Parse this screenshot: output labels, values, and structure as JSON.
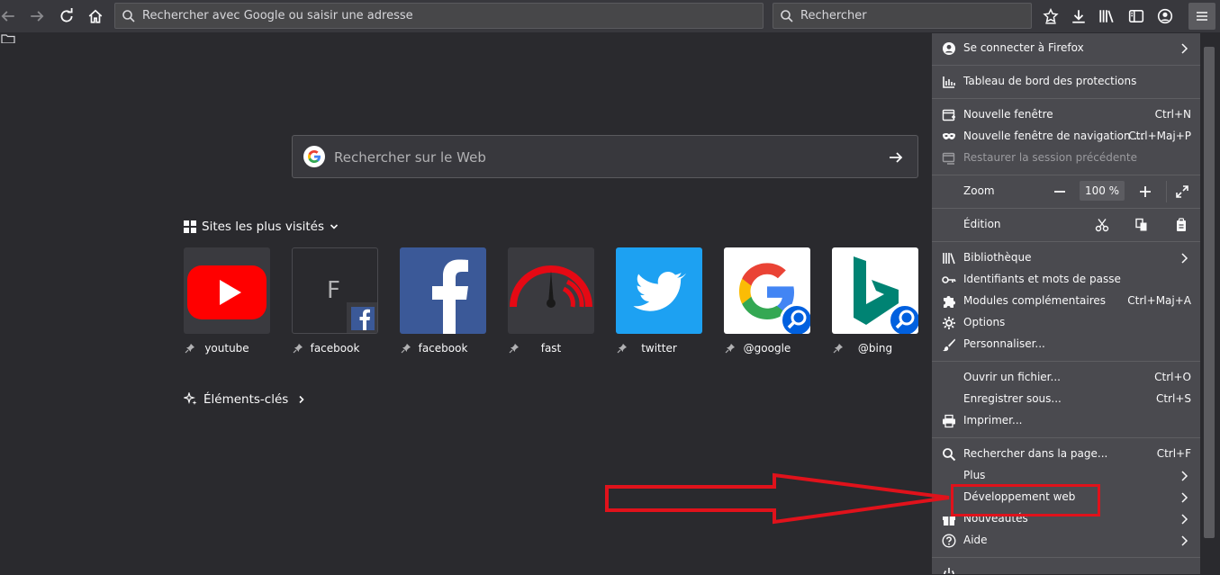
{
  "toolbar": {
    "url_placeholder": "Rechercher avec Google ou saisir une adresse",
    "search_placeholder": "Rechercher"
  },
  "newtab": {
    "web_search_placeholder": "Rechercher sur le Web",
    "top_sites_title": "Sites les plus visités",
    "highlights_title": "Éléments-clés",
    "tiles": [
      {
        "label": "youtube"
      },
      {
        "label": "facebook",
        "letter": "F"
      },
      {
        "label": "facebook"
      },
      {
        "label": "fast"
      },
      {
        "label": "twitter"
      },
      {
        "label": "@google"
      },
      {
        "label": "@bing"
      }
    ]
  },
  "menu": {
    "sign_in": "Se connecter à Firefox",
    "protections": "Tableau de bord des protections",
    "new_window": {
      "label": "Nouvelle fenêtre",
      "shortcut": "Ctrl+N"
    },
    "private_window": {
      "label": "Nouvelle fenêtre de navigation ...",
      "shortcut": "Ctrl+Maj+P"
    },
    "restore_session": "Restaurer la session précédente",
    "zoom": {
      "label": "Zoom",
      "value": "100 %"
    },
    "edit": "Édition",
    "library": "Bibliothèque",
    "logins": "Identifiants et mots de passe",
    "addons": {
      "label": "Modules complémentaires",
      "shortcut": "Ctrl+Maj+A"
    },
    "options": "Options",
    "customize": "Personnaliser...",
    "open_file": {
      "label": "Ouvrir un fichier...",
      "shortcut": "Ctrl+O"
    },
    "save_as": {
      "label": "Enregistrer sous...",
      "shortcut": "Ctrl+S"
    },
    "print": "Imprimer...",
    "find": {
      "label": "Rechercher dans la page...",
      "shortcut": "Ctrl+F"
    },
    "more": "Plus",
    "web_dev": "Développement web",
    "whats_new": "Nouveautés",
    "help": "Aide"
  },
  "colors": {
    "annotation": "#e0121b",
    "menu_bg": "#4a4a4f",
    "page_bg": "#2a2a2e"
  }
}
